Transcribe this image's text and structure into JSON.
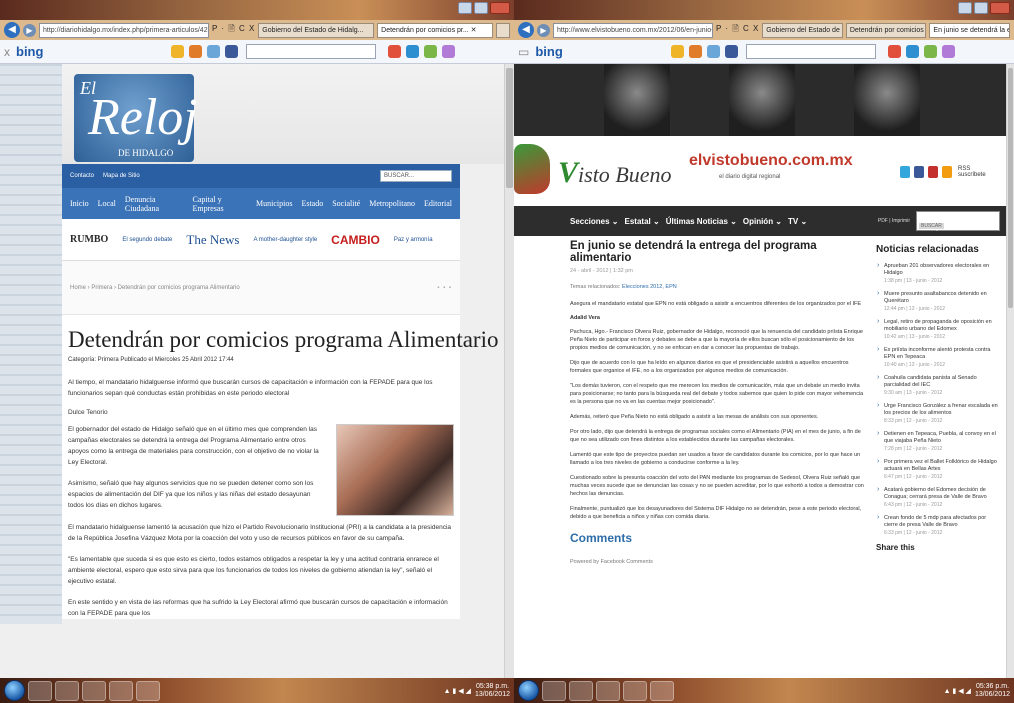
{
  "left": {
    "addr_url": "http://diariohidalgo.mx/index.php/primera-articulos/427-detendran-por-comicios-pro",
    "addr_tools": "P · 🗎 C X",
    "tabs": [
      {
        "label": "Gobierno del Estado de Hidalg..."
      },
      {
        "label": "Detendrán por comicios pr... ✕"
      }
    ],
    "bing": "bing",
    "site": {
      "logo_top": "El",
      "logo_main": "Reloj",
      "logo_sub": "DE HIDALGO",
      "topbar": [
        "Contacto",
        "Mapa de Sitio"
      ],
      "search_placeholder": "BUSCAR...",
      "nav": [
        "Inicio",
        "Local",
        "Denuncia Ciudadana",
        "Capital y Empresas",
        "Municipios",
        "Estado",
        "Socialité",
        "Metropolitano",
        "Editorial"
      ],
      "ads": {
        "rumbo": "RUMBO",
        "ad1": "El segundo debate",
        "thenews": "The News",
        "ad2": "A mother-daughter style",
        "cambio": "CAMBIO",
        "ad3": "Paz y armonía"
      },
      "breadcrumb": "Home  ›  Primera  ›  Detendrán por comicios programa Alimentario",
      "share": "▪ ▪ ▪",
      "article": {
        "title": "Detendrán por comicios programa Alimentario",
        "meta": "Categoría: Primera    Publicado el Miercoles 25 Abril 2012 17:44",
        "lead": "Al tiempo, el mandatario hidalguense informó que buscarán cursos de capacitación e información con la FEPADE para que los funcionarios sepan qué conductas están prohibidas en este periodo electoral",
        "author": "Dulce Tenorio",
        "paragraphs": [
          "El gobernador del estado de Hidalgo señaló que en el último mes que comprenden las campañas electorales se detendrá la entrega del Programa Alimentario entre otros apoyos como la entrega de materiales para construcción, con el objetivo de no violar la Ley Electoral.",
          "Asimismo, señaló que hay algunos servicios que no se pueden detener como son los espacios de alimentación del DIF ya que los niños y las niñas del estado desayunan todos los días en dichos lugares.",
          "El mandatario hidalguense lamentó la acusación que hizo el Partido Revolucionario Institucional (PRI) a la candidata a la presidencia de la República Josefina Vázquez Mota por la coacción del voto y uso de recursos públicos en favor de su campaña.",
          "\"Es lamentable que suceda si es que esto es cierto, todos estamos obligados a respetar la ley y una actitud contraria enrarece el ambiente electoral, espero que esto sirva para que los funcionarios de todos los niveles de gobierno atiendan la ley\", señaló el ejecutivo estatal.",
          "En este sentido y en vista de las reformas que ha sufrido la Ley Electoral afirmó que buscarán cursos de capacitación e información con la FEPADE para que los"
        ]
      }
    },
    "clock": {
      "time": "05:38 p.m.",
      "date": "13/06/2012"
    }
  },
  "right": {
    "addr_url": "http://www.elvistobueno.com.mx/2012/06/en-junio-se-detendra-la-entrega-del-prog",
    "addr_tools": "P · 🗎 C X",
    "tabs": [
      {
        "label": "Gobierno del Estado de Hi..."
      },
      {
        "label": "Detendrán por comicios p..."
      },
      {
        "label": "En junio se detendrá la e... ✕"
      }
    ],
    "bing": "bing",
    "site": {
      "logo_script": "isto",
      "logo_v": "V",
      "logo_bueno": "Bueno",
      "domain": "elvistobueno.com.mx",
      "tagline": "el diario digital regional",
      "rss": "RSS suscríbete",
      "nav": [
        "Secciones ⌄",
        "Estatal ⌄",
        "Últimas Noticias ⌄",
        "Opinión ⌄",
        "TV ⌄"
      ],
      "pdf": "PDF | Imprimir",
      "search_placeholder": "Escribe tu búsqueda",
      "search_button": "BUSCAR",
      "article": {
        "title": "En junio se detendrá la entrega del programa alimentario",
        "date": "24 - abril - 2012 | 1:32 pm",
        "topics_label": "Temas relacionados:",
        "topics": "Elecciones 2012, EPN",
        "lead": "Asegura el mandatario estatal que EPN no está obligado a asistir a encuentros diferentes de los organizados por el IFE",
        "author": "Adalid Vera",
        "paragraphs": [
          "Pachuca, Hgo.- Francisco Olvera Ruiz, gobernador de Hidalgo, reconoció que la renuencia del candidato priísta Enrique Peña Nieto de participar en foros y debates se debe a que la mayoría de ellos buscan sólo el posicionamiento de los propios medios de comunicación, y no se enfocan en dar a conocer las propuestas de trabajo.",
          "Dijo que de acuerdo con lo que ha leído en algunos diarios es que el presidenciable asistirá a aquellos encuentros formales que organice el IFE, no a los organizados por algunos medios de comunicación.",
          "\"Los demás tuvieron, con el respeto que me merecen los medios de comunicación, más que un debate un medio invita para posicionarse; no tanto para la búsqueda real del debate y todos sabemos que quien lo pide con mayor vehemencia es la persona que no va en las cuentas mejor posicionado\".",
          "Además, reiteró que Peña Nieto no está obligado a asistir a las mesas de análisis con sus oponentes.",
          "Por otro lado, dijo que detendrá la entrega de programas sociales como el Alimentario (PIA) en el mes de junio, a fin de que no sea utilizado con fines distintos a los establecidos durante las campañas electorales.",
          "Lamentó que este tipo de proyectos puedan ser usados a favor de candidatos durante los comicios, por lo que hace un llamado a los tres niveles de gobierno a conducirse conforme a la ley.",
          "Cuestionado sobre la presunta coacción del voto del PAN mediante los programas de Sedesol, Olvera Ruiz señaló que muchas veces sucede que se denuncian las cosas y no se pueden acreditar, por lo que exhortó a todos a demostrar con hechos las denuncias.",
          "Finalmente, puntualizó que los desayunadores del Sistema DIF Hidalgo no se detendrán, pese a este periodo electoral, debido a que beneficia a niños y niñas con comida diaria."
        ],
        "comments_heading": "Comments",
        "powered": "Powered by Facebook Comments"
      },
      "sidebar": {
        "title": "Noticias relacionadas",
        "items": [
          {
            "text": "Aprueban 201 observadores electorales en Hidalgo",
            "date": "1:38 pm | 13 - junio - 2012"
          },
          {
            "text": "Muere presunto asaltabancos detenido en Querétaro",
            "date": "12:44 pm | 13 - junio - 2012"
          },
          {
            "text": "Legal, retiro de propaganda de oposición en mobiliario urbano del Edomex",
            "date": "10:42 am | 13 - junio - 2012"
          },
          {
            "text": "Ex priísta inconforme alentó protesta contra EPN en Tepeaca",
            "date": "10:40 am | 13 - junio - 2012"
          },
          {
            "text": "Coahuila candidata panista al Senado parcialidad del IEC",
            "date": "9:30 am | 13 - junio - 2012"
          },
          {
            "text": "Urge Francisco González a frenar escalada en los precios de los alimentos",
            "date": "8:33 pm | 12 - junio - 2012"
          },
          {
            "text": "Detienen en Tepeaca, Puebla, al convoy en el que viajaba Peña Nieto",
            "date": "7:28 pm | 12 - junio - 2012"
          },
          {
            "text": "Por primera vez el Ballet Folklórico de Hidalgo actuará en Bellas Artes",
            "date": "6:47 pm | 12 - junio - 2012"
          },
          {
            "text": "Acatará gobierno del Edomex decisión de Conagua; cerrará presa de Valle de Bravo",
            "date": "6:43 pm | 12 - junio - 2012"
          },
          {
            "text": "Crean fondo de 5 mdp para afectados por cierre de presa Valle de Bravo",
            "date": "6:33 pm | 12 - junio - 2012"
          }
        ],
        "share": "Share this"
      }
    },
    "clock": {
      "time": "05:36 p.m.",
      "date": "13/06/2012"
    }
  }
}
